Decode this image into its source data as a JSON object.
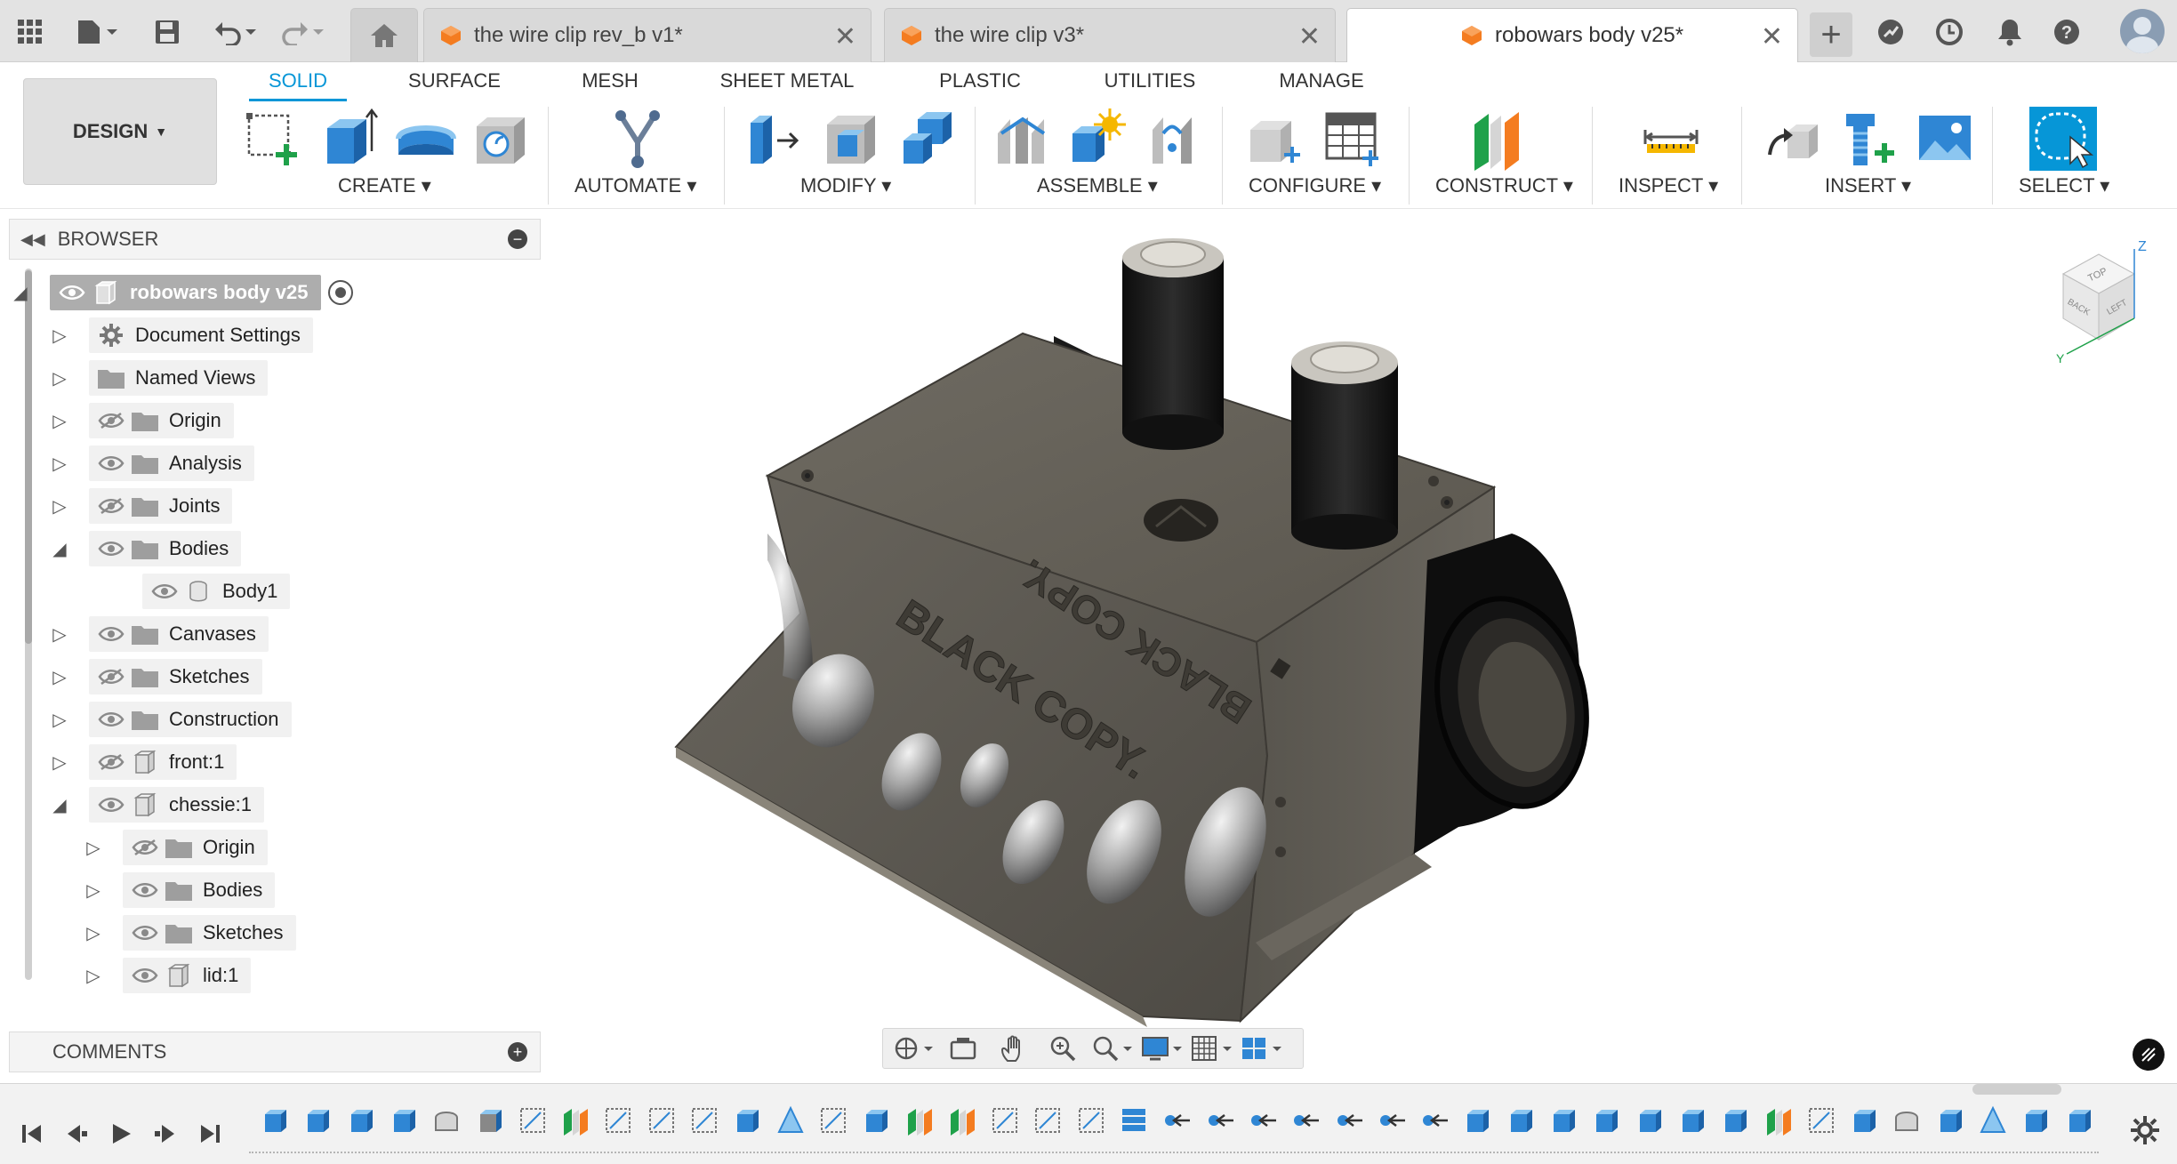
{
  "app": {
    "accent_color": "#0696d7",
    "tabs": [
      {
        "title": "the wire clip rev_b v1*",
        "active": false
      },
      {
        "title": "the wire clip v3*",
        "active": false
      },
      {
        "title": "robowars body v25*",
        "active": true
      }
    ],
    "title_icons": [
      "grid-icon",
      "file-icon",
      "save-icon",
      "undo-icon",
      "redo-icon",
      "home-icon",
      "add-tab-icon",
      "extensions-icon",
      "job-status-icon",
      "notifications-icon",
      "help-icon",
      "avatar"
    ]
  },
  "toolbar": {
    "workspace_label": "DESIGN",
    "workspace_tabs": [
      "SOLID",
      "SURFACE",
      "MESH",
      "SHEET METAL",
      "PLASTIC",
      "UTILITIES",
      "MANAGE"
    ],
    "active_workspace_tab": "SOLID",
    "groups": [
      {
        "label": "CREATE",
        "icons": [
          "create-sketch-icon",
          "extrude-icon",
          "revolve-icon",
          "hole-icon"
        ]
      },
      {
        "label": "AUTOMATE",
        "icons": [
          "automate-icon"
        ]
      },
      {
        "label": "MODIFY",
        "icons": [
          "press-pull-icon",
          "fillet-icon",
          "combine-icon"
        ]
      },
      {
        "label": "ASSEMBLE",
        "icons": [
          "joint-icon",
          "new-component-icon",
          "as-built-joint-icon"
        ]
      },
      {
        "label": "CONFIGURE",
        "icons": [
          "configure-icon",
          "configure-table-icon"
        ]
      },
      {
        "label": "CONSTRUCT",
        "icons": [
          "offset-plane-icon"
        ]
      },
      {
        "label": "INSPECT",
        "icons": [
          "measure-icon"
        ]
      },
      {
        "label": "INSERT",
        "icons": [
          "insert-derive-icon",
          "insert-mcmaster-icon",
          "insert-canvas-icon"
        ]
      },
      {
        "label": "SELECT",
        "icons": [
          "select-icon"
        ]
      }
    ]
  },
  "browser": {
    "title": "BROWSER",
    "tree": [
      {
        "label": "robowars body v25",
        "kind": "root",
        "expanded": true,
        "visible": true
      },
      {
        "label": "Document Settings",
        "kind": "settings",
        "expanded": false
      },
      {
        "label": "Named Views",
        "kind": "folder",
        "expanded": false
      },
      {
        "label": "Origin",
        "kind": "folder",
        "expanded": false,
        "visible": false
      },
      {
        "label": "Analysis",
        "kind": "folder",
        "expanded": false,
        "visible": true
      },
      {
        "label": "Joints",
        "kind": "folder",
        "expanded": false,
        "visible": false
      },
      {
        "label": "Bodies",
        "kind": "folder",
        "expanded": true,
        "visible": true
      },
      {
        "label": "Body1",
        "kind": "body",
        "visible": true
      },
      {
        "label": "Canvases",
        "kind": "folder",
        "expanded": false,
        "visible": true
      },
      {
        "label": "Sketches",
        "kind": "folder",
        "expanded": false,
        "visible": false
      },
      {
        "label": "Construction",
        "kind": "folder",
        "expanded": false,
        "visible": true
      },
      {
        "label": "front:1",
        "kind": "component",
        "expanded": false,
        "visible": false
      },
      {
        "label": "chessie:1",
        "kind": "component-root",
        "expanded": true,
        "visible": true
      },
      {
        "label": "Origin",
        "kind": "folder",
        "expanded": false,
        "visible": false
      },
      {
        "label": "Bodies",
        "kind": "folder",
        "expanded": false,
        "visible": true
      },
      {
        "label": "Sketches",
        "kind": "folder",
        "expanded": false,
        "visible": true
      },
      {
        "label": "lid:1",
        "kind": "component",
        "expanded": false,
        "visible": true
      }
    ]
  },
  "comments": {
    "title": "COMMENTS"
  },
  "viewport": {
    "model_text": "BLACK COPY.",
    "viewcube_faces": [
      "TOP",
      "BACK",
      "LEFT"
    ],
    "axis_labels": [
      "Z",
      "Y"
    ],
    "nav_icons": [
      "orbit-icon",
      "look-at-icon",
      "pan-icon",
      "zoom-icon",
      "fit-icon",
      "display-settings-icon",
      "grid-settings-icon",
      "viewports-icon"
    ]
  },
  "timeline": {
    "controls": [
      "skip-start-icon",
      "step-back-icon",
      "play-icon",
      "step-forward-icon",
      "skip-end-icon"
    ],
    "feature_count": 43
  }
}
